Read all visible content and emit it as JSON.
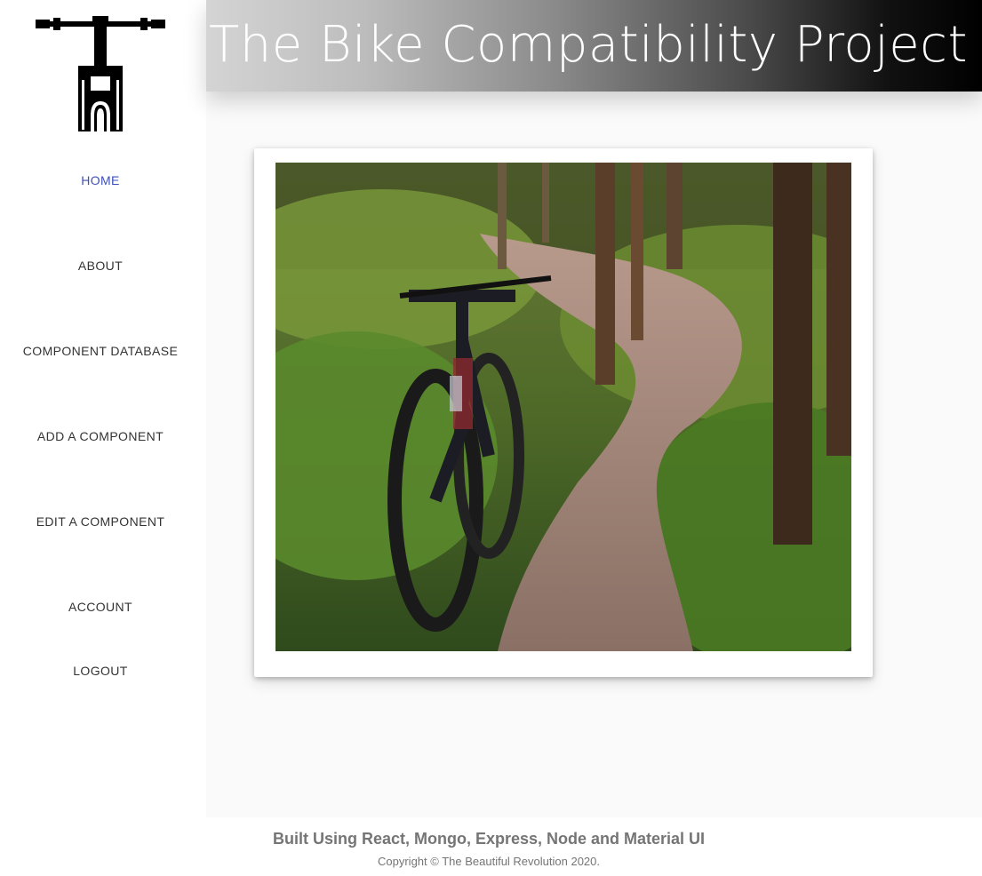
{
  "header": {
    "title": "The Bike Compatibility Project"
  },
  "sidebar": {
    "logo_icon": "bike-fork-logo-icon",
    "items": [
      {
        "label": "HOME",
        "active": true
      },
      {
        "label": "ABOUT",
        "active": false
      },
      {
        "label": "COMPONENT DATABASE",
        "active": false
      },
      {
        "label": "ADD A COMPONENT",
        "active": false
      },
      {
        "label": "EDIT A COMPONENT",
        "active": false
      },
      {
        "label": "ACCOUNT",
        "active": false
      },
      {
        "label": "LOGOUT",
        "active": false
      }
    ]
  },
  "main": {
    "hero_image": "mountain-bike-on-forest-trail"
  },
  "footer": {
    "built_with": "Built Using React, Mongo, Express, Node and Material UI",
    "copyright": "Copyright © The Beautiful Revolution 2020."
  },
  "colors": {
    "accent": "#3f51b5",
    "nav_text": "#333333",
    "footer_text": "#757575",
    "main_bg": "#fafafa"
  }
}
